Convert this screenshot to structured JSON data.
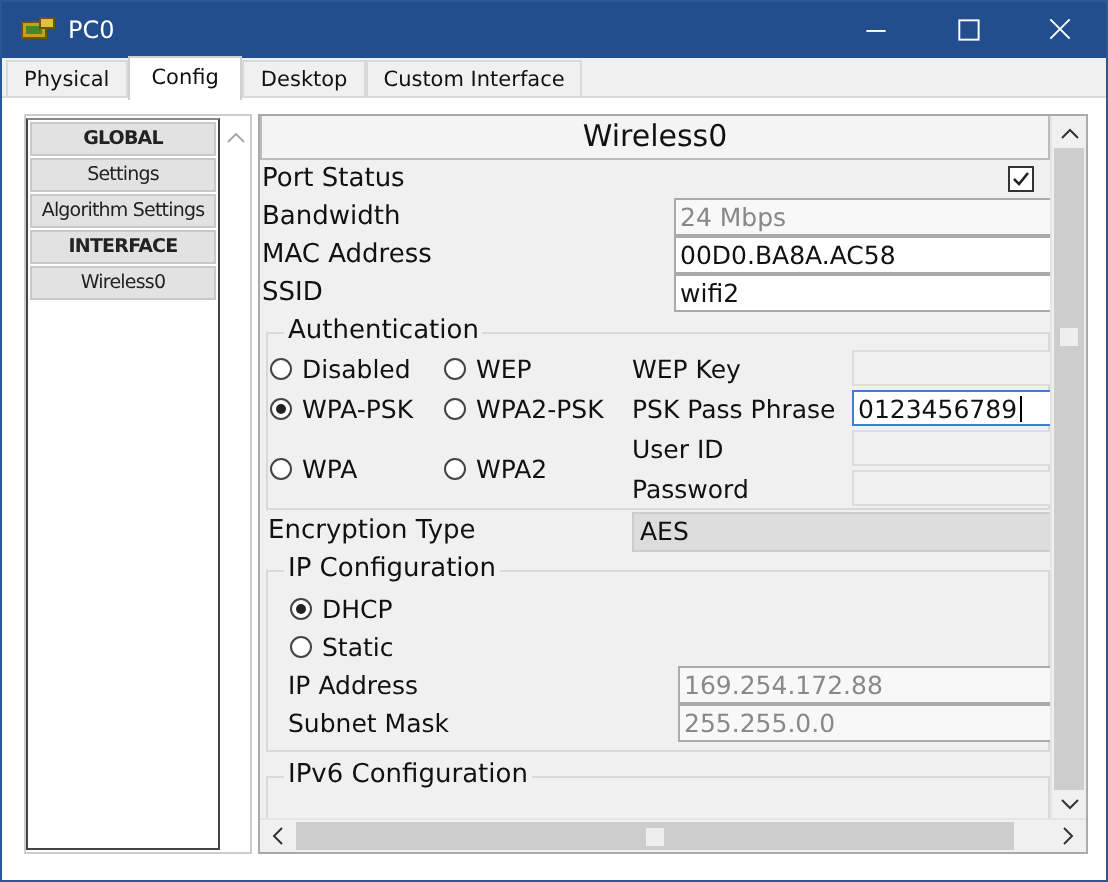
{
  "window": {
    "title": "PC0"
  },
  "tabs": [
    {
      "label": "Physical",
      "selected": false
    },
    {
      "label": "Config",
      "selected": true
    },
    {
      "label": "Desktop",
      "selected": false
    },
    {
      "label": "Custom Interface",
      "selected": false
    }
  ],
  "sidebar": {
    "items": [
      {
        "label": "GLOBAL",
        "kind": "header"
      },
      {
        "label": "Settings",
        "kind": "item"
      },
      {
        "label": "Algorithm Settings",
        "kind": "item"
      },
      {
        "label": "INTERFACE",
        "kind": "header"
      },
      {
        "label": "Wireless0",
        "kind": "item"
      }
    ]
  },
  "panel": {
    "title": "Wireless0",
    "port_status": {
      "label": "Port Status",
      "checked": true
    },
    "fields": [
      {
        "label": "Bandwidth",
        "value": "24 Mbps",
        "disabled": true
      },
      {
        "label": "MAC Address",
        "value": "00D0.BA8A.AC58",
        "disabled": false
      },
      {
        "label": "SSID",
        "value": "wifi2",
        "disabled": false
      }
    ],
    "authentication": {
      "title": "Authentication",
      "options": [
        {
          "label": "Disabled",
          "selected": false
        },
        {
          "label": "WEP",
          "selected": false
        },
        {
          "label": "WPA-PSK",
          "selected": true
        },
        {
          "label": "WPA2-PSK",
          "selected": false
        },
        {
          "label": "WPA",
          "selected": false
        },
        {
          "label": "WPA2",
          "selected": false
        }
      ],
      "fields": [
        {
          "label": "WEP Key",
          "focused": false
        },
        {
          "label": "PSK Pass Phrase",
          "value": "0123456789",
          "focused": true
        },
        {
          "label": "User ID",
          "focused": false
        },
        {
          "label": "Password",
          "focused": false
        }
      ]
    },
    "encryption": {
      "label": "Encryption Type",
      "value": "AES"
    },
    "ip_configuration": {
      "title": "IP Configuration",
      "options": [
        {
          "label": "DHCP",
          "selected": true
        },
        {
          "label": "Static",
          "selected": false
        }
      ],
      "fields": [
        {
          "label": "IP Address",
          "value": "169.254.172.88",
          "disabled": true
        },
        {
          "label": "Subnet Mask",
          "value": "255.255.0.0",
          "disabled": true
        }
      ]
    },
    "ipv6_title": "IPv6 Configuration"
  }
}
